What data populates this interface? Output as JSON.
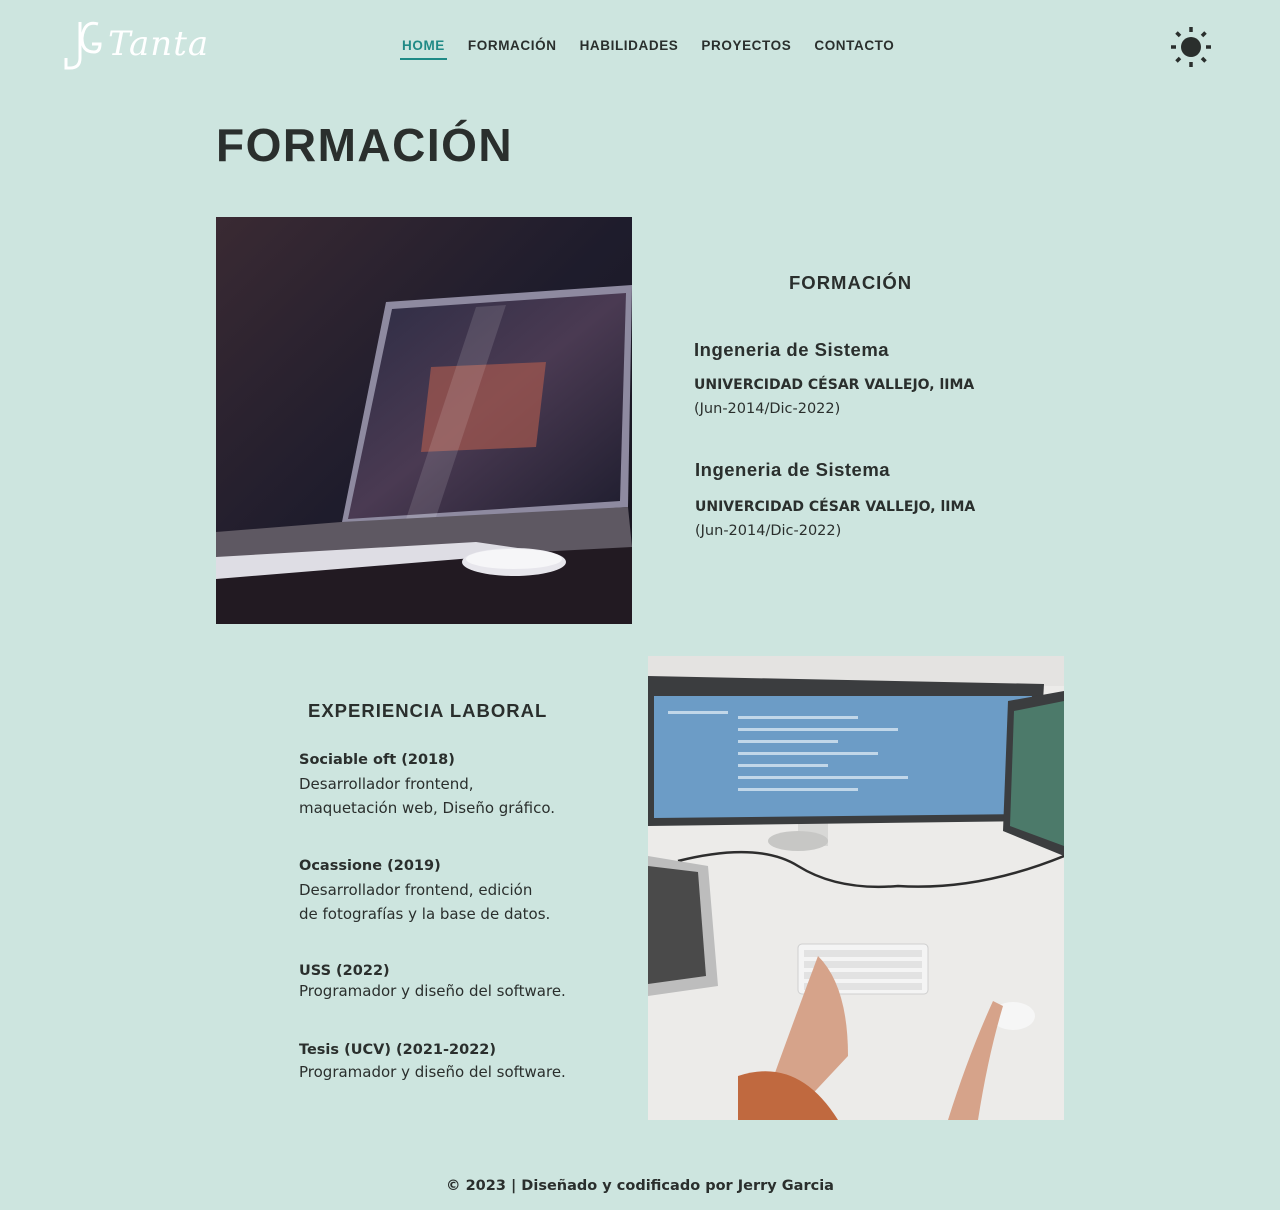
{
  "header": {
    "logo_text": "Tanta",
    "nav": [
      {
        "label": "HOME",
        "active": true
      },
      {
        "label": "FORMACIÓN",
        "active": false
      },
      {
        "label": "HABILIDADES",
        "active": false
      },
      {
        "label": "PROYECTOS",
        "active": false
      },
      {
        "label": "CONTACTO",
        "active": false
      }
    ],
    "theme_icon": "sun-icon"
  },
  "main": {
    "page_title": "FORMACIÓN",
    "education": {
      "title": "FORMACIÓN",
      "items": [
        {
          "degree": "Ingeneria de Sistema",
          "school": "UNIVERCIDAD CÉSAR VALLEJO, lIMA",
          "dates": "(Jun-2014/Dic-2022)"
        },
        {
          "degree": "Ingeneria de Sistema",
          "school": "UNIVERCIDAD CÉSAR VALLEJO, lIMA",
          "dates": "(Jun-2014/Dic-2022)"
        }
      ]
    },
    "experience": {
      "title": "EXPERIENCIA LABORAL",
      "items": [
        {
          "title": "Sociable oft (2018)",
          "description": "Desarrollador frontend,\nmaquetación web, Diseño gráfico."
        },
        {
          "title": "Ocassione (2019)",
          "description": "Desarrollador frontend, edición\nde fotografías y la base de datos."
        },
        {
          "title": "USS (2022)",
          "description": "Programador y diseño del software."
        },
        {
          "title": "Tesis (UCV) (2021-2022)",
          "description": "Programador y diseño del software."
        }
      ]
    }
  },
  "footer": {
    "text": "© 2023 | Diseñado y codificado por Jerry Garcia"
  },
  "colors": {
    "background": "#cde5df",
    "accent": "#1f8a86",
    "text": "#2a2f2d"
  }
}
